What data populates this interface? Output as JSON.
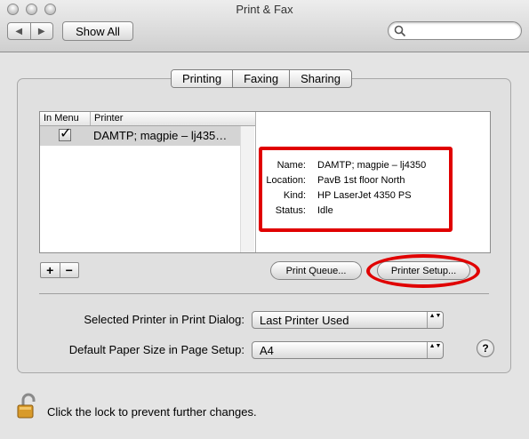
{
  "window": {
    "title": "Print & Fax"
  },
  "toolbar": {
    "back_glyph": "◀",
    "forward_glyph": "▶",
    "show_all_label": "Show All",
    "search_placeholder": ""
  },
  "tabs": [
    {
      "label": "Printing",
      "active": true
    },
    {
      "label": "Faxing",
      "active": false
    },
    {
      "label": "Sharing",
      "active": false
    }
  ],
  "printer_list": {
    "columns": [
      "In Menu",
      "Printer"
    ],
    "rows": [
      {
        "in_menu": true,
        "check_glyph": "✓",
        "name": "DAMTP; magpie – lj435…"
      }
    ]
  },
  "printer_info": {
    "fields": [
      {
        "label": "Name:",
        "value": "DAMTP; magpie – lj4350"
      },
      {
        "label": "Location:",
        "value": "PavB 1st floor North"
      },
      {
        "label": "Kind:",
        "value": "HP LaserJet 4350 PS"
      },
      {
        "label": "Status:",
        "value": "Idle"
      }
    ]
  },
  "list_controls": {
    "add_label": "+",
    "remove_label": "−"
  },
  "buttons": {
    "print_queue_label": "Print Queue...",
    "printer_setup_label": "Printer Setup..."
  },
  "settings": {
    "selected_printer_label": "Selected Printer in Print Dialog:",
    "selected_printer_value": "Last Printer Used",
    "paper_size_label": "Default Paper Size in Page Setup:",
    "paper_size_value": "A4",
    "popup_arrows": "▲▼"
  },
  "help": {
    "label": "?"
  },
  "footer": {
    "lock_text": "Click the lock to prevent further changes."
  },
  "colors": {
    "highlight": "#e00000"
  },
  "icons": [
    "close-icon",
    "minimize-icon",
    "zoom-icon",
    "search-icon",
    "checkbox-icon",
    "lock-icon",
    "help-icon"
  ]
}
